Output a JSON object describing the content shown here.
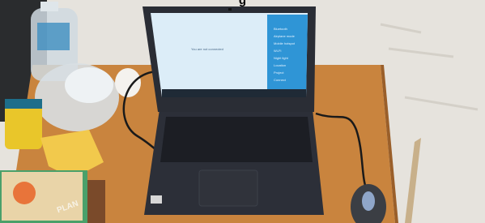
{
  "photo": {
    "top_caption_fragment": "g",
    "screen": {
      "page_heading": "You are not connected",
      "panel_items": [
        "Bluetooth",
        "Airplane mode",
        "Mobile hotspot",
        "Wi-Fi",
        "Night light",
        "Location",
        "Project",
        "Connect"
      ]
    },
    "book_cover_word": "PLAN"
  },
  "colors": {
    "wall": "#e8e6e1",
    "desk": "#c9843e",
    "laptop_body": "#2c2f38",
    "screen_blue": "#d9ecf8",
    "panel_blue": "#2f95d6",
    "taskbar": "#1f2a36"
  }
}
